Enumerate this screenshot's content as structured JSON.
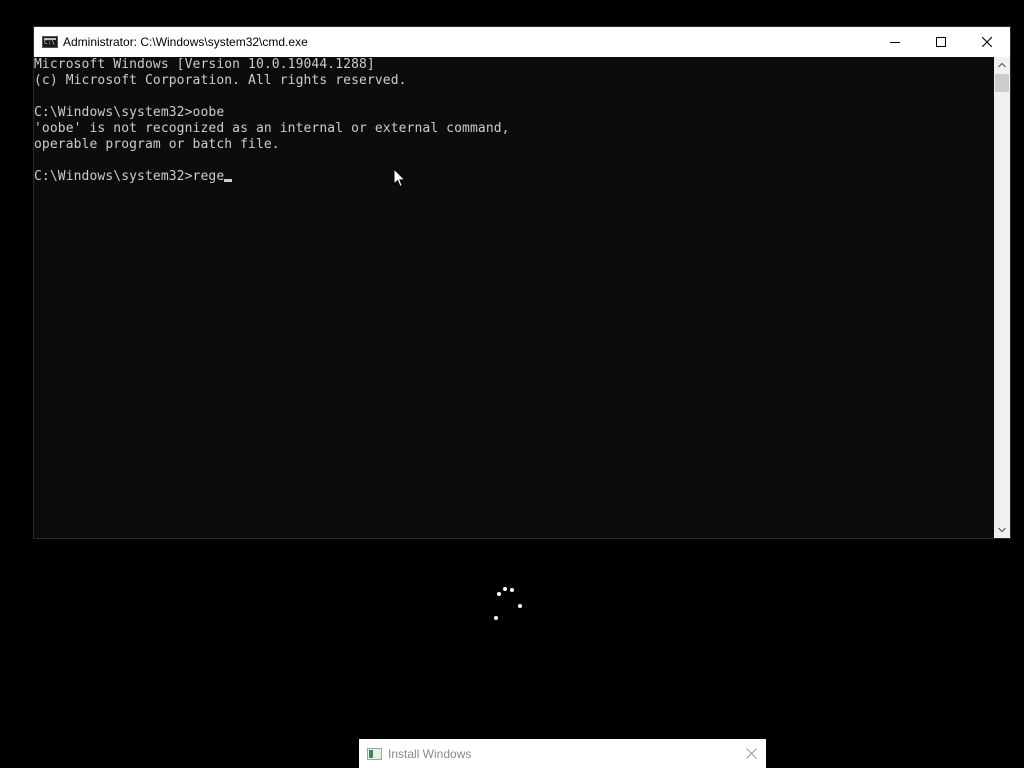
{
  "cmd_window": {
    "title": "Administrator: C:\\Windows\\system32\\cmd.exe",
    "icon": "cmd-icon",
    "controls": [
      "minimize-icon",
      "maximize-icon",
      "close-icon"
    ]
  },
  "console": {
    "lines": [
      "Microsoft Windows [Version 10.0.19044.1288]",
      "(c) Microsoft Corporation. All rights reserved.",
      "",
      "C:\\Windows\\system32>oobe",
      "'oobe' is not recognized as an internal or external command,",
      "operable program or batch file.",
      ""
    ],
    "prompt": "C:\\Windows\\system32>",
    "current_input": "rege"
  },
  "install_window": {
    "title": "Install Windows",
    "icon": "setup-icon",
    "close": "close-icon"
  },
  "colors": {
    "desktop": "#000000",
    "console_bg": "#0c0c0c",
    "console_text": "#cccccc",
    "titlebar": "#ffffff"
  }
}
